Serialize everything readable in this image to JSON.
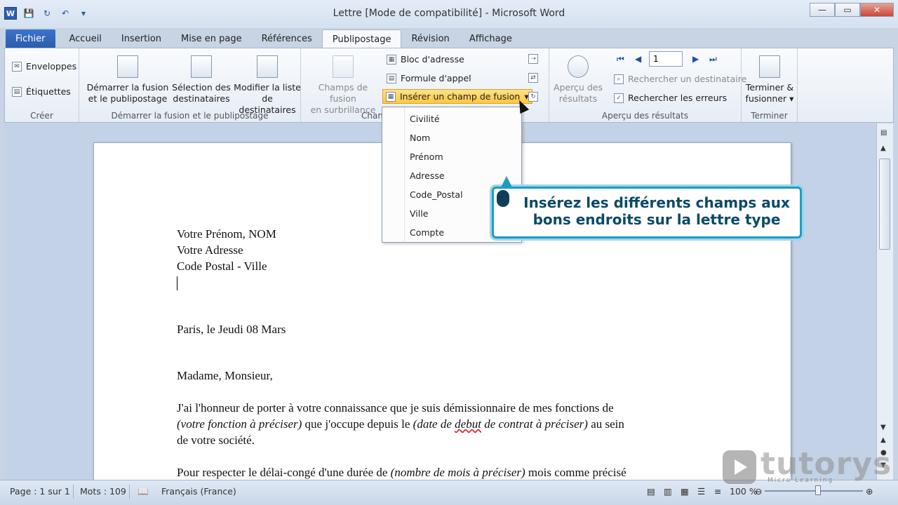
{
  "window": {
    "title": "Lettre [Mode de compatibilité] - Microsoft Word",
    "logo": "W"
  },
  "tabs": [
    "Fichier",
    "Accueil",
    "Insertion",
    "Mise en page",
    "Références",
    "Publipostage",
    "Révision",
    "Affichage"
  ],
  "active_tab": "Publipostage",
  "ribbon": {
    "creer": {
      "enveloppes": "Enveloppes",
      "etiquettes": "Étiquettes",
      "label": "Créer"
    },
    "demarrer": {
      "demarrer_fusion": "Démarrer la fusion",
      "demarrer_fusion_2": "et le publipostage",
      "selection": "Sélection des",
      "selection_2": "destinataires",
      "modifier": "Modifier la liste",
      "modifier_2": "de destinataires",
      "label": "Démarrer la fusion et le publipostage"
    },
    "champs": {
      "surbrillance": "Champs de fusion",
      "surbrillance_2": "en surbrillance",
      "bloc": "Bloc d'adresse",
      "formule": "Formule d'appel",
      "inserer": "Insérer un champ de fusion",
      "label": "Cham"
    },
    "apercu": {
      "apercu": "Aperçu des",
      "apercu_2": "résultats",
      "record": "1",
      "rechercher_dest": "Rechercher un destinataire",
      "rechercher_err": "Rechercher les erreurs",
      "label": "Aperçu des résultats"
    },
    "terminer": {
      "terminer": "Terminer &",
      "terminer_2": "fusionner",
      "label": "Terminer"
    }
  },
  "dropdown": {
    "items": [
      "Civilité",
      "Nom",
      "Prénom",
      "Adresse",
      "Code_Postal",
      "Ville",
      "Compte"
    ]
  },
  "callout": {
    "line1": "Insérez les différents champs aux",
    "line2": "bons endroits sur la lettre type"
  },
  "document": {
    "l1": "Votre Prénom, NOM",
    "l2": "Votre Adresse",
    "l3": "Code Postal - Ville",
    "date": "Paris, le Jeudi 08 Mars",
    "greeting": "Madame, Monsieur,",
    "p1a": "J'ai l'honneur de porter à votre connaissance que je suis démissionnaire de mes fonctions de",
    "p1b_ital": "(votre fonction à préciser)",
    "p1c": " que j'occupe depuis le ",
    "p1d_ital": "(date de ",
    "p1d_squig": "debut",
    "p1e_ital": " de contrat à préciser)",
    "p1f": " au sein",
    "p1g": "de votre société.",
    "p2a": "Pour respecter le délai-congé d'une durée de ",
    "p2b_ital": "(nombre de mois à préciser)",
    "p2c": " mois comme précisé"
  },
  "status": {
    "page": "Page : 1 sur 1",
    "words": "Mots : 109",
    "language": "Français (France)",
    "zoom": "100 %"
  },
  "watermark": {
    "brand": "tutorys",
    "sub": "Micro Learning"
  }
}
